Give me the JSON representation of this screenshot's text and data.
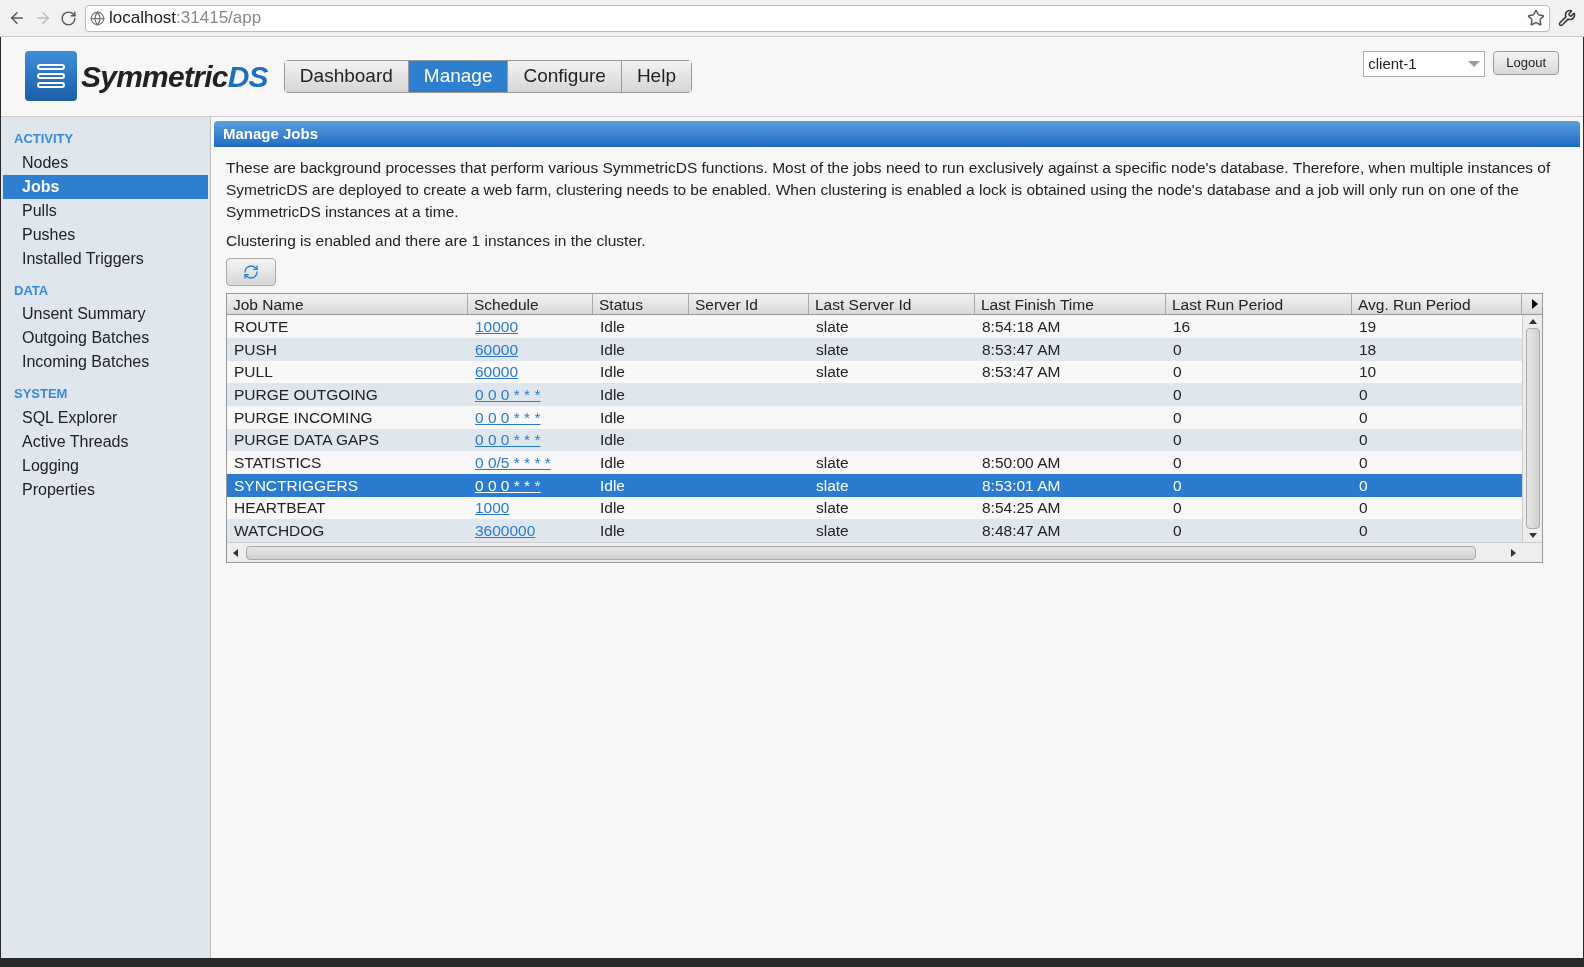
{
  "browser": {
    "url_host": "localhost",
    "url_path": ":31415/app"
  },
  "logo": {
    "name": "Symmetric",
    "suffix": "DS"
  },
  "nav": [
    {
      "label": "Dashboard",
      "selected": false
    },
    {
      "label": "Manage",
      "selected": true
    },
    {
      "label": "Configure",
      "selected": false
    },
    {
      "label": "Help",
      "selected": false
    }
  ],
  "node_select": {
    "value": "client-1"
  },
  "logout_button": "Logout",
  "sidebar": [
    {
      "heading": "ACTIVITY",
      "items": [
        {
          "label": "Nodes",
          "selected": false
        },
        {
          "label": "Jobs",
          "selected": true
        },
        {
          "label": "Pulls",
          "selected": false
        },
        {
          "label": "Pushes",
          "selected": false
        },
        {
          "label": "Installed Triggers",
          "selected": false
        }
      ]
    },
    {
      "heading": "DATA",
      "items": [
        {
          "label": "Unsent Summary",
          "selected": false
        },
        {
          "label": "Outgoing Batches",
          "selected": false
        },
        {
          "label": "Incoming Batches",
          "selected": false
        }
      ]
    },
    {
      "heading": "SYSTEM",
      "items": [
        {
          "label": "SQL Explorer",
          "selected": false
        },
        {
          "label": "Active Threads",
          "selected": false
        },
        {
          "label": "Logging",
          "selected": false
        },
        {
          "label": "Properties",
          "selected": false
        }
      ]
    }
  ],
  "panel": {
    "title": "Manage Jobs",
    "description": "These are background processes that perform various SymmetricDS functions. Most of the jobs need to run exclusively against a specific node's database. Therefore, when multiple instances of SymetricDS are deployed to create a web farm, clustering needs to be enabled. When clustering is enabled a lock is obtained using the node's database and a job will only run on one of the SymmetricDS instances at a time.",
    "cluster_note": "Clustering is enabled and there are 1 instances in the cluster.",
    "table": {
      "columns": [
        "Job Name",
        "Schedule",
        "Status",
        "Server Id",
        "Last Server Id",
        "Last Finish Time",
        "Last Run Period",
        "Avg. Run Period"
      ],
      "rows": [
        {
          "selected": false,
          "cells": [
            "ROUTE",
            "10000",
            "Idle",
            "",
            "slate",
            "8:54:18 AM",
            "16",
            "19"
          ]
        },
        {
          "selected": false,
          "cells": [
            "PUSH",
            "60000",
            "Idle",
            "",
            "slate",
            "8:53:47 AM",
            "0",
            "18"
          ]
        },
        {
          "selected": false,
          "cells": [
            "PULL",
            "60000",
            "Idle",
            "",
            "slate",
            "8:53:47 AM",
            "0",
            "10"
          ]
        },
        {
          "selected": false,
          "cells": [
            "PURGE OUTGOING",
            "0 0 0 * * *",
            "Idle",
            "",
            "",
            "",
            "0",
            "0"
          ]
        },
        {
          "selected": false,
          "cells": [
            "PURGE INCOMING",
            "0 0 0 * * *",
            "Idle",
            "",
            "",
            "",
            "0",
            "0"
          ]
        },
        {
          "selected": false,
          "cells": [
            "PURGE DATA GAPS",
            "0 0 0 * * *",
            "Idle",
            "",
            "",
            "",
            "0",
            "0"
          ]
        },
        {
          "selected": false,
          "cells": [
            "STATISTICS",
            "0 0/5 * * * *",
            "Idle",
            "",
            "slate",
            "8:50:00 AM",
            "0",
            "0"
          ]
        },
        {
          "selected": true,
          "cells": [
            "SYNCTRIGGERS",
            "0 0 0 * * *",
            "Idle",
            "",
            "slate",
            "8:53:01 AM",
            "0",
            "0"
          ]
        },
        {
          "selected": false,
          "cells": [
            "HEARTBEAT",
            "1000",
            "Idle",
            "",
            "slate",
            "8:54:25 AM",
            "0",
            "0"
          ]
        },
        {
          "selected": false,
          "cells": [
            "WATCHDOG",
            "3600000",
            "Idle",
            "",
            "slate",
            "8:48:47 AM",
            "0",
            "0"
          ]
        }
      ]
    }
  }
}
